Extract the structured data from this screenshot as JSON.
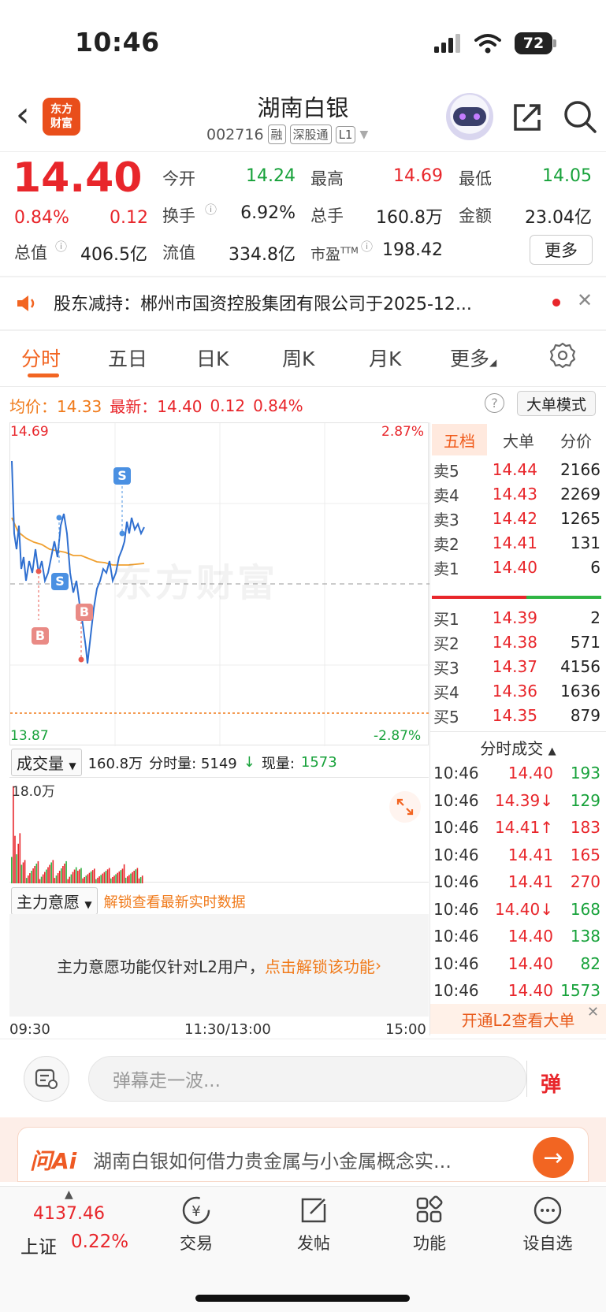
{
  "status": {
    "time": "10:46",
    "battery": "72"
  },
  "header": {
    "logo_line1": "东方",
    "logo_line2": "财富",
    "stock_name": "湖南白银",
    "stock_code": "002716",
    "tags": [
      "融",
      "深股通",
      "L1"
    ]
  },
  "quote": {
    "price": "14.40",
    "pct": "0.84%",
    "change": "0.12",
    "open_label": "今开",
    "open": "14.24",
    "high_label": "最高",
    "high": "14.69",
    "low_label": "最低",
    "low": "14.05",
    "turnover_label": "换手",
    "turnover": "6.92%",
    "volume_label": "总手",
    "volume": "160.8万",
    "amount_label": "金额",
    "amount": "23.04亿",
    "mktcap_label": "总值",
    "mktcap": "406.5亿",
    "float_label": "流值",
    "float": "334.8亿",
    "pe_label": "市盈",
    "pe_sup": "TTM",
    "pe": "198.42",
    "more_label": "更多"
  },
  "notice": {
    "text": "股东减持：郴州市国资控股集团有限公司于2025-12..."
  },
  "tabs": [
    "分时",
    "五日",
    "日K",
    "周K",
    "月K",
    "更多"
  ],
  "info": {
    "avg_label": "均价：",
    "avg": "14.33",
    "latest_label": "最新：",
    "latest": "14.40",
    "chg": "0.12",
    "pct": "0.84%",
    "bigorder_label": "大单模式"
  },
  "chart_data": {
    "type": "line",
    "y_high": "14.69",
    "y_low": "13.87",
    "pct_high": "2.87%",
    "pct_low": "-2.87%",
    "prev_close": 14.28,
    "markers": [
      "S",
      "S",
      "B",
      "B"
    ],
    "watermark": "东方财富",
    "x_ticks": [
      "09:30",
      "11:30/13:00",
      "15:00"
    ]
  },
  "volume": {
    "select_label": "成交量",
    "total": "160.8万",
    "interval": "分时量: 5149",
    "now_label": "现量:",
    "now": "1573",
    "max": "18.0万"
  },
  "main": {
    "select_label": "主力意愿",
    "unlock_text": "解锁查看最新实时数据",
    "l2_text": "主力意愿功能仅针对L2用户，",
    "l2_link": "点击解锁该功能"
  },
  "panel": {
    "tabs": [
      "五档",
      "大单",
      "分价"
    ],
    "sell": [
      {
        "label": "卖5",
        "price": "14.44",
        "vol": "2166"
      },
      {
        "label": "卖4",
        "price": "14.43",
        "vol": "2269"
      },
      {
        "label": "卖3",
        "price": "14.42",
        "vol": "1265"
      },
      {
        "label": "卖2",
        "price": "14.41",
        "vol": "131"
      },
      {
        "label": "卖1",
        "price": "14.40",
        "vol": "6"
      }
    ],
    "buy": [
      {
        "label": "买1",
        "price": "14.39",
        "vol": "2"
      },
      {
        "label": "买2",
        "price": "14.38",
        "vol": "571"
      },
      {
        "label": "买3",
        "price": "14.37",
        "vol": "4156"
      },
      {
        "label": "买4",
        "price": "14.36",
        "vol": "1636"
      },
      {
        "label": "买5",
        "price": "14.35",
        "vol": "879"
      }
    ],
    "ticks_header": "分时成交",
    "ticks": [
      {
        "time": "10:46",
        "price": "14.40",
        "vol": "193",
        "dir": "",
        "color": "green"
      },
      {
        "time": "10:46",
        "price": "14.39↓",
        "vol": "129",
        "dir": "down",
        "color": "green"
      },
      {
        "time": "10:46",
        "price": "14.41↑",
        "vol": "183",
        "dir": "up",
        "color": "red"
      },
      {
        "time": "10:46",
        "price": "14.41",
        "vol": "165",
        "dir": "",
        "color": "red"
      },
      {
        "time": "10:46",
        "price": "14.41",
        "vol": "270",
        "dir": "",
        "color": "red"
      },
      {
        "time": "10:46",
        "price": "14.40↓",
        "vol": "168",
        "dir": "down",
        "color": "green"
      },
      {
        "time": "10:46",
        "price": "14.40",
        "vol": "138",
        "dir": "",
        "color": "green"
      },
      {
        "time": "10:46",
        "price": "14.40",
        "vol": "82",
        "dir": "",
        "color": "green"
      },
      {
        "time": "10:46",
        "price": "14.40",
        "vol": "1573",
        "dir": "",
        "color": "green"
      }
    ],
    "l2_open": "开通L2查看大单"
  },
  "danmu": {
    "placeholder": "弹幕走一波...",
    "send": "弹"
  },
  "ai": {
    "logo": "问Ai",
    "text": "湖南白银如何借力贵金属与小金属概念实..."
  },
  "bottom": {
    "index_value": "4137.46",
    "index_name": "上证",
    "index_pct": "0.22%",
    "items": [
      "交易",
      "发帖",
      "功能",
      "设自选"
    ]
  }
}
